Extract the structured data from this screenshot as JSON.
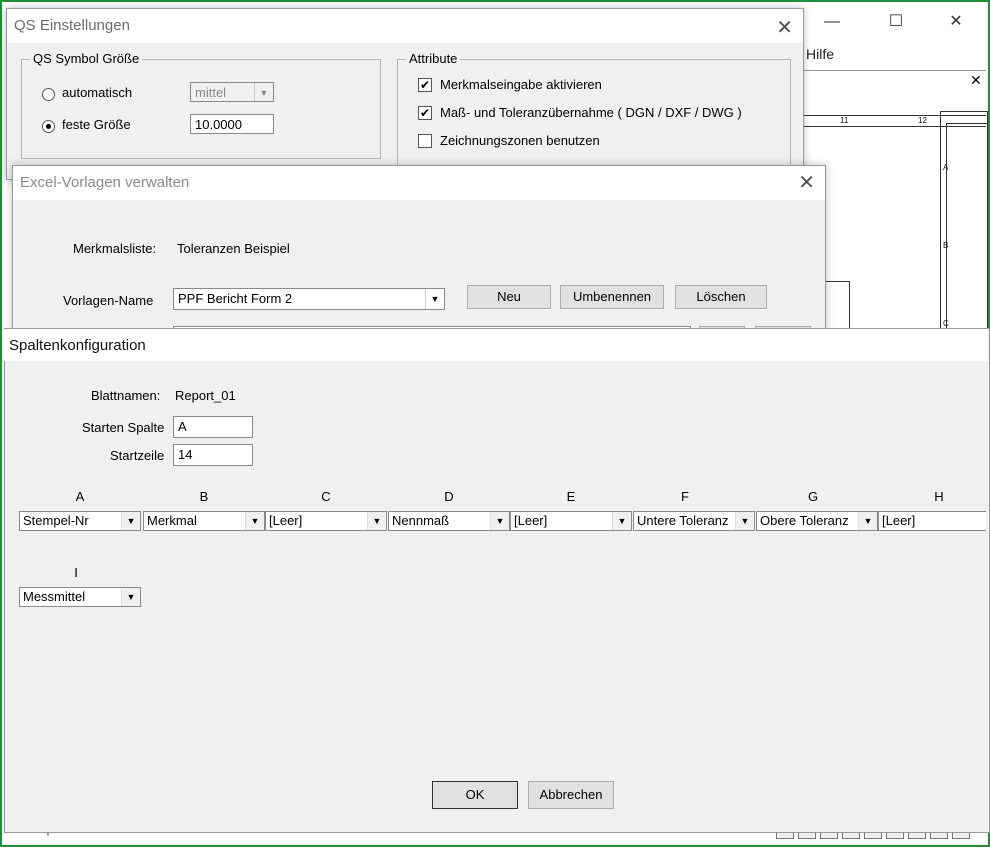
{
  "background_app": {
    "menu_help": "Hilfe",
    "window_controls": {
      "minimize": "—",
      "maximize": "☐",
      "close": "✕"
    },
    "drawing_close": "✕",
    "drawing_ticks": {
      "col11": "11",
      "col12": "12",
      "rowA": "A",
      "rowB": "B",
      "rowC": "C"
    },
    "status_text": "Eine Option wählen"
  },
  "qs_dialog": {
    "title": "QS Einstellungen",
    "close": "✕",
    "symbol_group": {
      "label": "QS Symbol Größe",
      "auto_label": "automatisch",
      "auto_select_value": "mittel",
      "fixed_label": "feste Größe",
      "fixed_value": "10.0000",
      "selected": "fixed"
    },
    "attr_group": {
      "label": "Attribute",
      "items": [
        {
          "label": "Merkmalseingabe aktivieren",
          "checked": true
        },
        {
          "label": "Maß- und Toleranzübernahme ( DGN / DXF / DWG )",
          "checked": true
        },
        {
          "label": "Zeichnungszonen benutzen",
          "checked": false
        }
      ]
    }
  },
  "excel_dialog": {
    "title": "Excel-Vorlagen verwalten",
    "close": "✕",
    "list_label": "Merkmalsliste:",
    "list_value": "Toleranzen Beispiel",
    "template_label": "Vorlagen-Name",
    "template_value": "PPF Bericht Form 2",
    "btn_new": "Neu",
    "btn_rename": "Umbenennen",
    "btn_delete": "Löschen"
  },
  "spalten_dialog": {
    "title": "Spaltenkonfiguration",
    "sheet_label": "Blattnamen:",
    "sheet_value": "Report_01",
    "start_col_label": "Starten Spalte",
    "start_col_value": "A",
    "start_row_label": "Startzeile",
    "start_row_value": "14",
    "columns": [
      {
        "letter": "A",
        "value": "Stempel-Nr"
      },
      {
        "letter": "B",
        "value": "Merkmal"
      },
      {
        "letter": "C",
        "value": "[Leer]"
      },
      {
        "letter": "D",
        "value": "Nennmaß"
      },
      {
        "letter": "E",
        "value": "[Leer]"
      },
      {
        "letter": "F",
        "value": "Untere Toleranz"
      },
      {
        "letter": "G",
        "value": "Obere Toleranz"
      },
      {
        "letter": "H",
        "value": "[Leer]"
      },
      {
        "letter": "I",
        "value": "Messmittel"
      }
    ],
    "ok": "OK",
    "cancel": "Abbrechen"
  }
}
